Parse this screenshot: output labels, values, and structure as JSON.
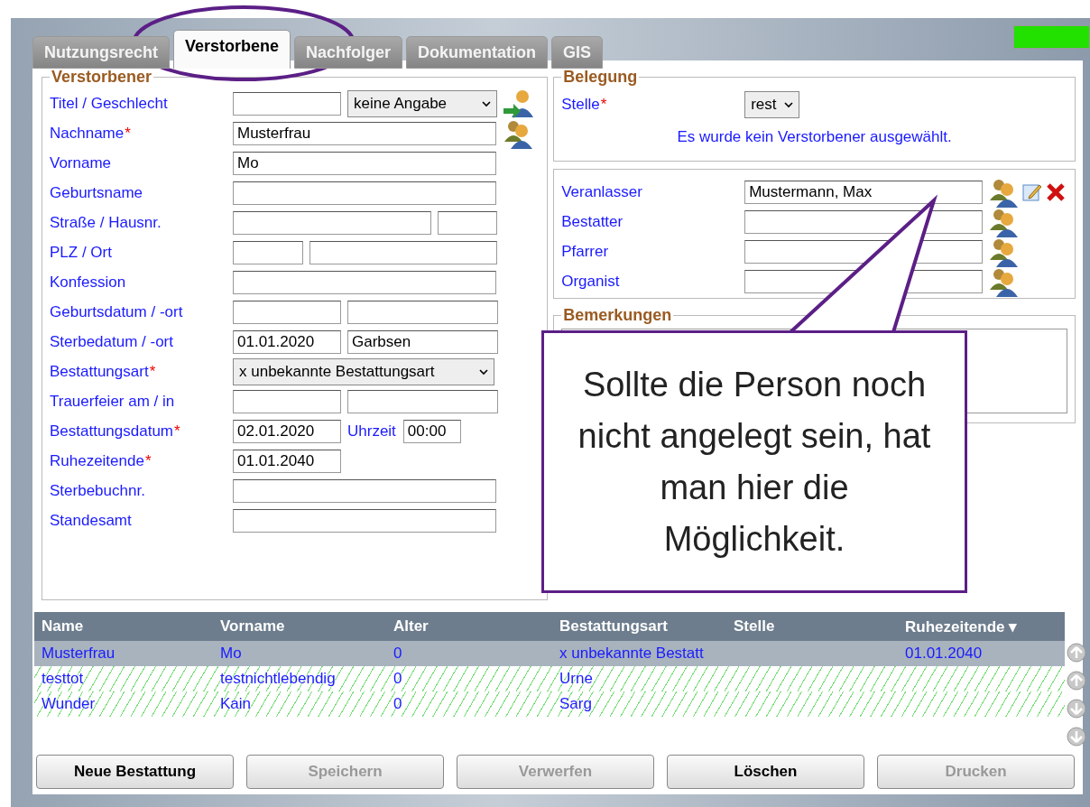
{
  "tabs": [
    {
      "label": "Nutzungsrecht",
      "selected": false
    },
    {
      "label": "Verstorbene",
      "selected": true
    },
    {
      "label": "Nachfolger",
      "selected": false
    },
    {
      "label": "Dokumentation",
      "selected": false
    },
    {
      "label": "GIS",
      "selected": false
    }
  ],
  "deceased": {
    "legend": "Verstorbener",
    "rows": [
      {
        "label": "Titel / Geschlecht",
        "fields": [
          {
            "kind": "input"
          },
          {
            "kind": "select",
            "value": "keine Angabe"
          }
        ]
      },
      {
        "label": "Nachname",
        "mark": "*",
        "fields": [
          {
            "kind": "input",
            "value": "Musterfrau"
          }
        ]
      },
      {
        "label": "Vorname",
        "fields": [
          {
            "kind": "input",
            "value": "Mo"
          }
        ]
      },
      {
        "label": "Geburtsname",
        "fields": [
          {
            "kind": "input"
          }
        ]
      },
      {
        "label": "Straße / Hausnr.",
        "fields": [
          {
            "kind": "input"
          },
          {
            "kind": "input"
          }
        ]
      },
      {
        "label": "PLZ / Ort",
        "fields": [
          {
            "kind": "input"
          },
          {
            "kind": "input"
          }
        ]
      },
      {
        "label": "Konfession",
        "fields": [
          {
            "kind": "input"
          }
        ]
      },
      {
        "label": "Geburtsdatum / -ort",
        "fields": [
          {
            "kind": "input"
          },
          {
            "kind": "input"
          }
        ]
      },
      {
        "label": "Sterbedatum / -ort",
        "fields": [
          {
            "kind": "input",
            "value": "01.01.2020"
          },
          {
            "kind": "input",
            "value": "Garbsen"
          }
        ]
      },
      {
        "label": "Bestattungsart",
        "mark": "*",
        "fields": [
          {
            "kind": "select",
            "value": "x unbekannte Bestattungsart"
          }
        ]
      },
      {
        "label": "Trauerfeier am / in",
        "fields": [
          {
            "kind": "input"
          },
          {
            "kind": "input"
          }
        ]
      },
      {
        "label": "Bestattungsdatum",
        "mark": "*",
        "fields": [
          {
            "kind": "input",
            "value": "02.01.2020"
          },
          {
            "kind": "label",
            "value": "Uhrzeit"
          },
          {
            "kind": "input",
            "value": "00:00"
          }
        ]
      },
      {
        "label": "Ruhezeitende",
        "mark": "*",
        "fields": [
          {
            "kind": "input",
            "value": "01.01.2040"
          }
        ]
      },
      {
        "label": "Sterbebuchnr.",
        "fields": [
          {
            "kind": "input"
          }
        ]
      },
      {
        "label": "Standesamt",
        "fields": [
          {
            "kind": "input"
          }
        ]
      }
    ]
  },
  "allocation": {
    "legend": "Belegung",
    "stelle_label": "Stelle",
    "stelle_mark": "*",
    "stelle_value": "rest",
    "message": "Es wurde kein Verstorbener ausgewählt."
  },
  "persons": [
    {
      "label": "Veranlasser",
      "value": "Mustermann, Max",
      "editable": true
    },
    {
      "label": "Bestatter",
      "editable": false
    },
    {
      "label": "Pfarrer",
      "editable": false
    },
    {
      "label": "Organist",
      "editable": false
    }
  ],
  "remarks": {
    "legend": "Bemerkungen"
  },
  "callout": "Sollte die Person noch nicht angelegt sein, hat man hier die Möglichkeit.",
  "table": {
    "columns": [
      "Name",
      "Vorname",
      "Alter",
      "Bestattungsart",
      "Stelle",
      "Ruhezeitende ▾"
    ],
    "rows": [
      {
        "cells": [
          "Musterfrau",
          "Mo",
          "0",
          "x unbekannte Bestatt",
          null,
          "01.01.2040"
        ],
        "selected": true,
        "hatched": false
      },
      {
        "cells": [
          "testtot",
          "testnichtlebendig",
          "0",
          "Urne",
          null,
          null
        ],
        "selected": false,
        "hatched": true
      },
      {
        "cells": [
          "Wunder",
          "Kain",
          "0",
          "Sarg",
          null,
          null
        ],
        "selected": false,
        "hatched": true
      }
    ]
  },
  "buttons": [
    {
      "label": "Neue Bestattung",
      "disabled": false
    },
    {
      "label": "Speichern",
      "disabled": true
    },
    {
      "label": "Verwerfen",
      "disabled": true
    },
    {
      "label": "Löschen",
      "disabled": false
    },
    {
      "label": "Drucken",
      "disabled": true
    }
  ]
}
